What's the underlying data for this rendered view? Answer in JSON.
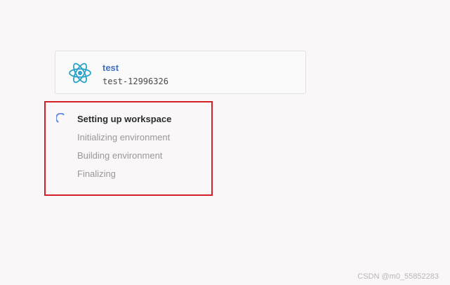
{
  "project": {
    "name": "test",
    "id": "test-12996326",
    "icon": "react-icon",
    "icon_color": "#2aa3c7"
  },
  "setup": {
    "status_icon": "spinner-icon",
    "accent_color": "#6d8fe0",
    "steps": [
      {
        "label": "Setting up workspace",
        "state": "active"
      },
      {
        "label": "Initializing environment",
        "state": "pending"
      },
      {
        "label": "Building environment",
        "state": "pending"
      },
      {
        "label": "Finalizing",
        "state": "pending"
      }
    ]
  },
  "watermark": {
    "text": "CSDN @m0_55852283"
  }
}
